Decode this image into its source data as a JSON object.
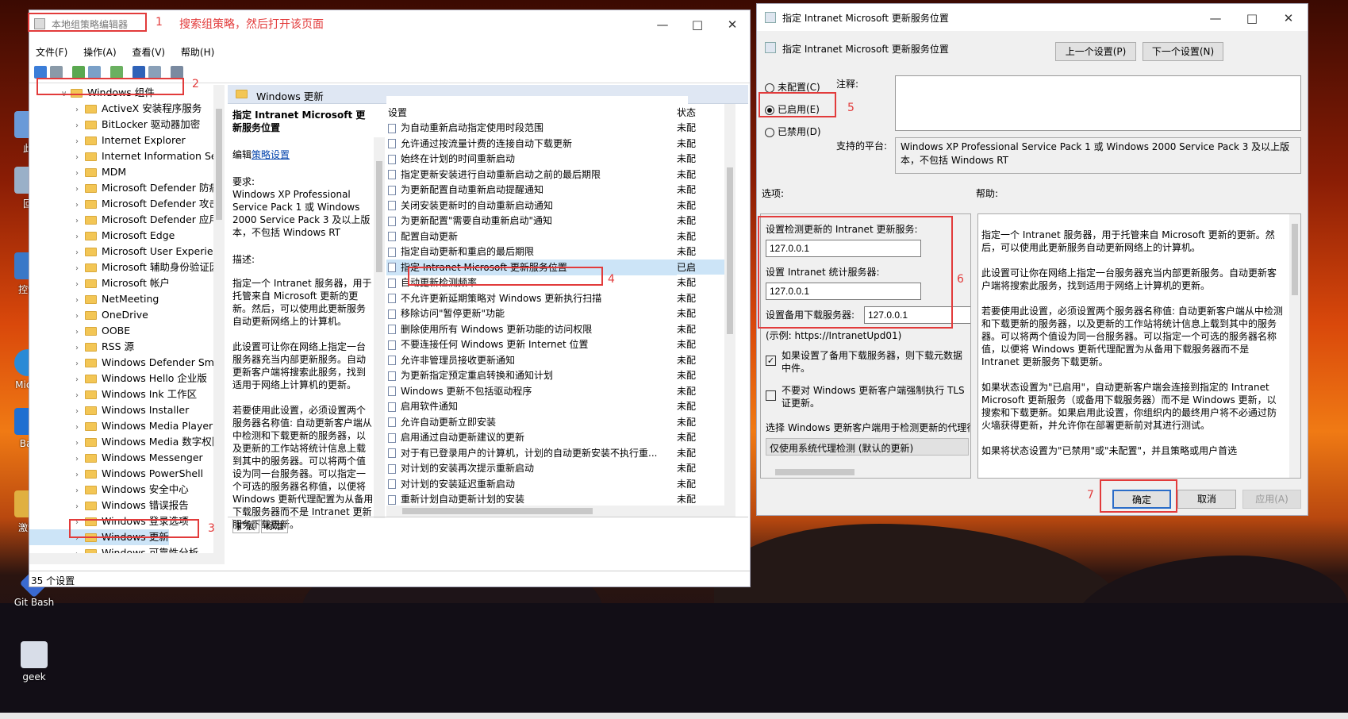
{
  "desktop": {
    "icons": [
      {
        "label": "此"
      },
      {
        "label": "回"
      },
      {
        "label": "控制"
      },
      {
        "label": "Mic E"
      },
      {
        "label": "Bar"
      },
      {
        "label": "激活"
      },
      {
        "label": "Git Bash"
      },
      {
        "label": "geek"
      }
    ]
  },
  "gpedit": {
    "title": "本地组策略编辑器",
    "menu": [
      "文件(F)",
      "操作(A)",
      "查看(V)",
      "帮助(H)"
    ],
    "tree": [
      {
        "label": "Windows 组件",
        "expanded": true
      },
      {
        "label": "ActiveX 安装程序服务"
      },
      {
        "label": "BitLocker 驱动器加密"
      },
      {
        "label": "Internet Explorer"
      },
      {
        "label": "Internet Information Servi"
      },
      {
        "label": "MDM"
      },
      {
        "label": "Microsoft Defender 防病毒"
      },
      {
        "label": "Microsoft Defender 攻击防"
      },
      {
        "label": "Microsoft Defender 应用程"
      },
      {
        "label": "Microsoft Edge"
      },
      {
        "label": "Microsoft User Experienc"
      },
      {
        "label": "Microsoft 辅助身份验证因素"
      },
      {
        "label": "Microsoft 帐户"
      },
      {
        "label": "NetMeeting"
      },
      {
        "label": "OneDrive"
      },
      {
        "label": "OOBE"
      },
      {
        "label": "RSS 源"
      },
      {
        "label": "Windows Defender Smart"
      },
      {
        "label": "Windows Hello 企业版"
      },
      {
        "label": "Windows Ink 工作区"
      },
      {
        "label": "Windows Installer"
      },
      {
        "label": "Windows Media Player"
      },
      {
        "label": "Windows Media 数字权限管"
      },
      {
        "label": "Windows Messenger"
      },
      {
        "label": "Windows PowerShell"
      },
      {
        "label": "Windows 安全中心"
      },
      {
        "label": "Windows 错误报告"
      },
      {
        "label": "Windows 登录选项"
      },
      {
        "label": "Windows 更新",
        "selected": true
      },
      {
        "label": "Windows 可靠性分析"
      }
    ],
    "folder_header": "Windows 更新",
    "detail": {
      "title": "指定 Intranet Microsoft 更新服务位置",
      "edit_prefix": "编辑",
      "edit_link": "策略设置",
      "req_label": "要求:",
      "req_text": "Windows XP Professional Service Pack 1 或 Windows 2000 Service Pack 3 及以上版本，不包括 Windows RT",
      "desc_label": "描述:",
      "desc_text": "指定一个 Intranet 服务器，用于托管来自 Microsoft 更新的更新。然后，可以使用此更新服务自动更新网络上的计算机。\n\n此设置可让你在网络上指定一台服务器充当内部更新服务。自动更新客户端将搜索此服务，找到适用于网络上计算机的更新。\n\n若要使用此设置，必须设置两个服务器名称值: 自动更新客户端从中检测和下载更新的服务器，以及更新的工作站将统计信息上载到其中的服务器。可以将两个值设为同一台服务器。可以指定一个可选的服务器名称值，以便将 Windows 更新代理配置为从备用下载服务器而不是 Intranet 更新服务下载更新。"
    },
    "list_header_setting": "设置",
    "list_header_state": "状态",
    "settings": [
      {
        "name": "为自动重新启动指定使用时段范围",
        "state": "未配"
      },
      {
        "name": "允许通过按流量计费的连接自动下载更新",
        "state": "未配"
      },
      {
        "name": "始终在计划的时间重新启动",
        "state": "未配"
      },
      {
        "name": "指定更新安装进行自动重新启动之前的最后期限",
        "state": "未配"
      },
      {
        "name": "为更新配置自动重新启动提醒通知",
        "state": "未配"
      },
      {
        "name": "关闭安装更新时的自动重新启动通知",
        "state": "未配"
      },
      {
        "name": "为更新配置\"需要自动重新启动\"通知",
        "state": "未配"
      },
      {
        "name": "配置自动更新",
        "state": "未配"
      },
      {
        "name": "指定自动更新和重启的最后期限",
        "state": "未配"
      },
      {
        "name": "指定 Intranet Microsoft 更新服务位置",
        "state": "已启",
        "selected": true
      },
      {
        "name": "自动更新检测频率",
        "state": "未配"
      },
      {
        "name": "不允许更新延期策略对 Windows 更新执行扫描",
        "state": "未配"
      },
      {
        "name": "移除访问\"暂停更新\"功能",
        "state": "未配"
      },
      {
        "name": "删除使用所有 Windows 更新功能的访问权限",
        "state": "未配"
      },
      {
        "name": "不要连接任何 Windows 更新 Internet 位置",
        "state": "未配"
      },
      {
        "name": "允许非管理员接收更新通知",
        "state": "未配"
      },
      {
        "name": "为更新指定预定重启转换和通知计划",
        "state": "未配"
      },
      {
        "name": "Windows 更新不包括驱动程序",
        "state": "未配"
      },
      {
        "name": "启用软件通知",
        "state": "未配"
      },
      {
        "name": "允许自动更新立即安装",
        "state": "未配"
      },
      {
        "name": "启用通过自动更新建议的更新",
        "state": "未配"
      },
      {
        "name": "对于有已登录用户的计算机，计划的自动更新安装不执行重...",
        "state": "未配"
      },
      {
        "name": "对计划的安装再次提示重新启动",
        "state": "未配"
      },
      {
        "name": "对计划的安装延迟重新启动",
        "state": "未配"
      },
      {
        "name": "重新计划自动更新计划的安装",
        "state": "未配"
      }
    ],
    "tabs": [
      "扩展",
      "标准"
    ],
    "status": "35 个设置"
  },
  "annotations": {
    "n1": "1",
    "n1_text": "搜索组策略，然后打开该页面",
    "n2": "2",
    "n3": "3",
    "n4": "4",
    "n5": "5",
    "n6": "6",
    "n7": "7"
  },
  "dialog": {
    "title": "指定 Intranet Microsoft 更新服务位置",
    "heading": "指定 Intranet Microsoft 更新服务位置",
    "prev_btn": "上一个设置(P)",
    "next_btn": "下一个设置(N)",
    "radio_not_configured": "未配置(C)",
    "radio_enabled": "已启用(E)",
    "radio_disabled": "已禁用(D)",
    "comment_label": "注释:",
    "platform_label": "支持的平台:",
    "platform_text": "Windows XP Professional Service Pack 1 或 Windows 2000 Service Pack 3 及以上版本，不包括 Windows RT",
    "options_label": "选项:",
    "help_label": "帮助:",
    "opt_detect_label": "设置检测更新的 Intranet 更新服务:",
    "opt_detect_value": "127.0.0.1",
    "opt_stats_label": "设置 Intranet 统计服务器:",
    "opt_stats_value": "127.0.0.1",
    "opt_alt_label": "设置备用下载服务器:",
    "opt_alt_value": "127.0.0.1",
    "opt_example": "(示例:    https://IntranetUpd01)",
    "opt_check1": "如果设置了备用下载服务器，则下载元数据中件。",
    "opt_check2": "不要对 Windows 更新客户端强制执行 TLS 证更新。",
    "opt_select_label": "选择 Windows 更新客户端用于检测更新的代理行",
    "opt_select_value": "仅使用系统代理检测 (默认的更新)",
    "help_text": "指定一个 Intranet 服务器，用于托管来自 Microsoft 更新的更新。然后，可以使用此更新服务自动更新网络上的计算机。\n\n此设置可让你在网络上指定一台服务器充当内部更新服务。自动更新客户端将搜索此服务，找到适用于网络上计算机的更新。\n\n若要使用此设置，必须设置两个服务器名称值: 自动更新客户端从中检测和下载更新的服务器，以及更新的工作站将统计信息上载到其中的服务器。可以将两个值设为同一台服务器。可以指定一个可选的服务器名称值，以便将 Windows 更新代理配置为从备用下载服务器而不是 Intranet 更新服务下载更新。\n\n如果状态设置为\"已启用\"，自动更新客户端会连接到指定的 Intranet Microsoft 更新服务（或备用下载服务器）而不是 Windows 更新，以搜索和下载更新。如果启用此设置，你组织内的最终用户将不必通过防火墙获得更新，并允许你在部署更新前对其进行测试。\n\n如果将状态设置为\"已禁用\"或\"未配置\"，并且策略或用户首选",
    "ok_btn": "确定",
    "cancel_btn": "取消",
    "apply_btn": "应用(A)"
  }
}
